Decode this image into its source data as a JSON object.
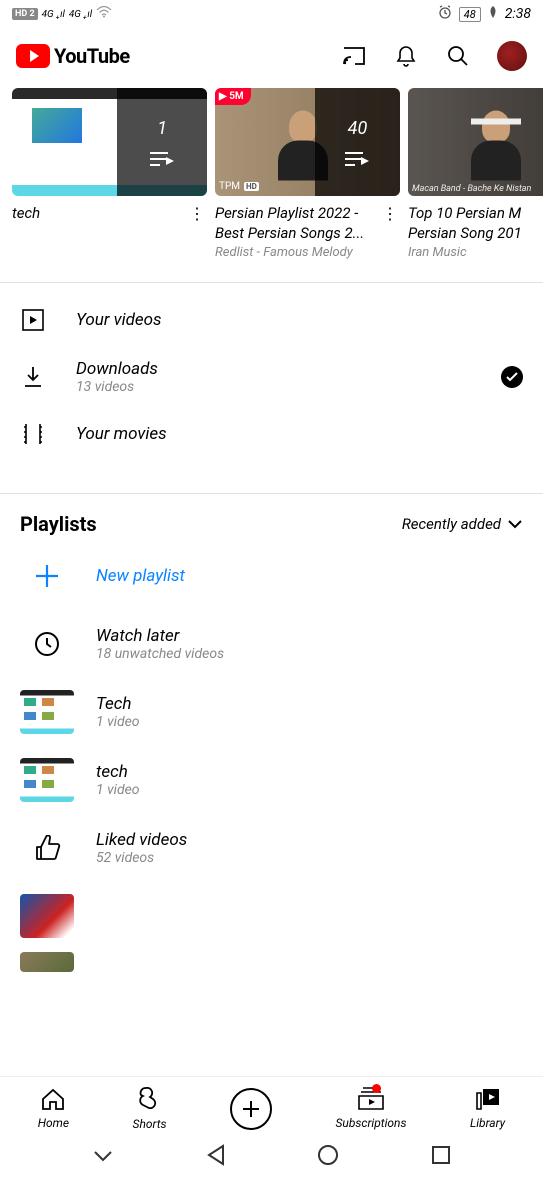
{
  "status": {
    "hd_badge": "HD 2",
    "sig1": "4G",
    "sig2": "4G",
    "battery": "48",
    "time": "2:38"
  },
  "header": {
    "brand": "YouTube"
  },
  "carousel": [
    {
      "count": "1",
      "title": "tech",
      "subtitle": ""
    },
    {
      "badge_views": "5M",
      "thumb_brand": "TPM",
      "thumb_hd": "HD",
      "count": "40",
      "title": "Persian Playlist 2022 - Best Persian Songs 2...",
      "subtitle": "Redlist - Famous Melody"
    },
    {
      "thumb_caption": "Macan Band - Bache Ke Nistan",
      "title": "Top 10 Persian M\nPersian Song 201",
      "subtitle": "Iran Music"
    }
  ],
  "menu": {
    "your_videos": "Your videos",
    "downloads_title": "Downloads",
    "downloads_sub": "13 videos",
    "your_movies": "Your movies"
  },
  "playlists": {
    "heading": "Playlists",
    "sort_label": "Recently added",
    "new_playlist": "New playlist",
    "watch_later_title": "Watch later",
    "watch_later_sub": "18 unwatched videos",
    "items": [
      {
        "title": "Tech",
        "sub": "1 video"
      },
      {
        "title": "tech",
        "sub": "1 video"
      }
    ],
    "liked_title": "Liked videos",
    "liked_sub": "52 videos"
  },
  "bottom_nav": {
    "home": "Home",
    "shorts": "Shorts",
    "subscriptions": "Subscriptions",
    "library": "Library"
  }
}
